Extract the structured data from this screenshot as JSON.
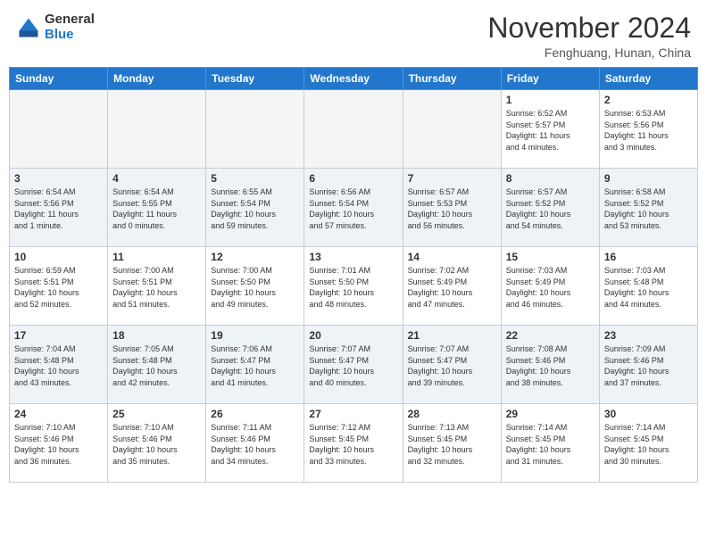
{
  "logo": {
    "general": "General",
    "blue": "Blue"
  },
  "title": "November 2024",
  "location": "Fenghuang, Hunan, China",
  "weekdays": [
    "Sunday",
    "Monday",
    "Tuesday",
    "Wednesday",
    "Thursday",
    "Friday",
    "Saturday"
  ],
  "weeks": [
    [
      {
        "day": "",
        "info": ""
      },
      {
        "day": "",
        "info": ""
      },
      {
        "day": "",
        "info": ""
      },
      {
        "day": "",
        "info": ""
      },
      {
        "day": "",
        "info": ""
      },
      {
        "day": "1",
        "info": "Sunrise: 6:52 AM\nSunset: 5:57 PM\nDaylight: 11 hours\nand 4 minutes."
      },
      {
        "day": "2",
        "info": "Sunrise: 6:53 AM\nSunset: 5:56 PM\nDaylight: 11 hours\nand 3 minutes."
      }
    ],
    [
      {
        "day": "3",
        "info": "Sunrise: 6:54 AM\nSunset: 5:56 PM\nDaylight: 11 hours\nand 1 minute."
      },
      {
        "day": "4",
        "info": "Sunrise: 6:54 AM\nSunset: 5:55 PM\nDaylight: 11 hours\nand 0 minutes."
      },
      {
        "day": "5",
        "info": "Sunrise: 6:55 AM\nSunset: 5:54 PM\nDaylight: 10 hours\nand 59 minutes."
      },
      {
        "day": "6",
        "info": "Sunrise: 6:56 AM\nSunset: 5:54 PM\nDaylight: 10 hours\nand 57 minutes."
      },
      {
        "day": "7",
        "info": "Sunrise: 6:57 AM\nSunset: 5:53 PM\nDaylight: 10 hours\nand 56 minutes."
      },
      {
        "day": "8",
        "info": "Sunrise: 6:57 AM\nSunset: 5:52 PM\nDaylight: 10 hours\nand 54 minutes."
      },
      {
        "day": "9",
        "info": "Sunrise: 6:58 AM\nSunset: 5:52 PM\nDaylight: 10 hours\nand 53 minutes."
      }
    ],
    [
      {
        "day": "10",
        "info": "Sunrise: 6:59 AM\nSunset: 5:51 PM\nDaylight: 10 hours\nand 52 minutes."
      },
      {
        "day": "11",
        "info": "Sunrise: 7:00 AM\nSunset: 5:51 PM\nDaylight: 10 hours\nand 51 minutes."
      },
      {
        "day": "12",
        "info": "Sunrise: 7:00 AM\nSunset: 5:50 PM\nDaylight: 10 hours\nand 49 minutes."
      },
      {
        "day": "13",
        "info": "Sunrise: 7:01 AM\nSunset: 5:50 PM\nDaylight: 10 hours\nand 48 minutes."
      },
      {
        "day": "14",
        "info": "Sunrise: 7:02 AM\nSunset: 5:49 PM\nDaylight: 10 hours\nand 47 minutes."
      },
      {
        "day": "15",
        "info": "Sunrise: 7:03 AM\nSunset: 5:49 PM\nDaylight: 10 hours\nand 46 minutes."
      },
      {
        "day": "16",
        "info": "Sunrise: 7:03 AM\nSunset: 5:48 PM\nDaylight: 10 hours\nand 44 minutes."
      }
    ],
    [
      {
        "day": "17",
        "info": "Sunrise: 7:04 AM\nSunset: 5:48 PM\nDaylight: 10 hours\nand 43 minutes."
      },
      {
        "day": "18",
        "info": "Sunrise: 7:05 AM\nSunset: 5:48 PM\nDaylight: 10 hours\nand 42 minutes."
      },
      {
        "day": "19",
        "info": "Sunrise: 7:06 AM\nSunset: 5:47 PM\nDaylight: 10 hours\nand 41 minutes."
      },
      {
        "day": "20",
        "info": "Sunrise: 7:07 AM\nSunset: 5:47 PM\nDaylight: 10 hours\nand 40 minutes."
      },
      {
        "day": "21",
        "info": "Sunrise: 7:07 AM\nSunset: 5:47 PM\nDaylight: 10 hours\nand 39 minutes."
      },
      {
        "day": "22",
        "info": "Sunrise: 7:08 AM\nSunset: 5:46 PM\nDaylight: 10 hours\nand 38 minutes."
      },
      {
        "day": "23",
        "info": "Sunrise: 7:09 AM\nSunset: 5:46 PM\nDaylight: 10 hours\nand 37 minutes."
      }
    ],
    [
      {
        "day": "24",
        "info": "Sunrise: 7:10 AM\nSunset: 5:46 PM\nDaylight: 10 hours\nand 36 minutes."
      },
      {
        "day": "25",
        "info": "Sunrise: 7:10 AM\nSunset: 5:46 PM\nDaylight: 10 hours\nand 35 minutes."
      },
      {
        "day": "26",
        "info": "Sunrise: 7:11 AM\nSunset: 5:46 PM\nDaylight: 10 hours\nand 34 minutes."
      },
      {
        "day": "27",
        "info": "Sunrise: 7:12 AM\nSunset: 5:45 PM\nDaylight: 10 hours\nand 33 minutes."
      },
      {
        "day": "28",
        "info": "Sunrise: 7:13 AM\nSunset: 5:45 PM\nDaylight: 10 hours\nand 32 minutes."
      },
      {
        "day": "29",
        "info": "Sunrise: 7:14 AM\nSunset: 5:45 PM\nDaylight: 10 hours\nand 31 minutes."
      },
      {
        "day": "30",
        "info": "Sunrise: 7:14 AM\nSunset: 5:45 PM\nDaylight: 10 hours\nand 30 minutes."
      }
    ]
  ]
}
